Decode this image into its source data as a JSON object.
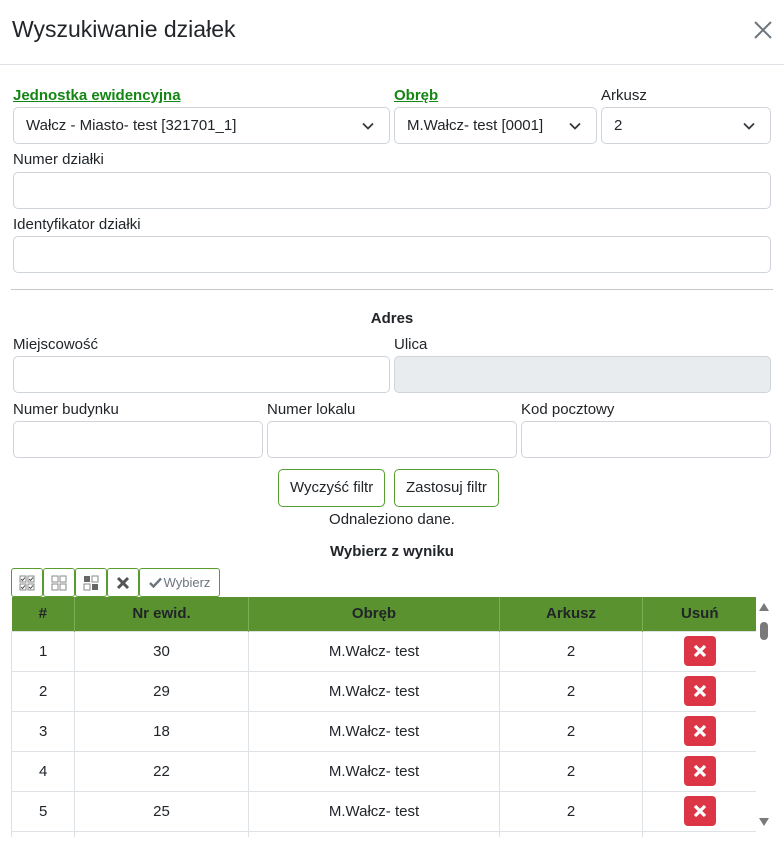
{
  "modal": {
    "title": "Wyszukiwanie działek"
  },
  "form": {
    "jednostka_label": "Jednostka ewidencyjna",
    "jednostka_value": "Wałcz - Miasto- test [321701_1]",
    "obreb_label": "Obręb",
    "obreb_value": "M.Wałcz- test [0001]",
    "arkusz_label": "Arkusz",
    "arkusz_value": "2",
    "numer_dzialki_label": "Numer działki",
    "identyfikator_label": "Identyfikator działki"
  },
  "address": {
    "heading": "Adres",
    "miejscowosc_label": "Miejscowość",
    "ulica_label": "Ulica",
    "numer_budynku_label": "Numer budynku",
    "numer_lokalu_label": "Numer lokalu",
    "kod_pocztowy_label": "Kod pocztowy"
  },
  "actions": {
    "clear_label": "Wyczyść filtr",
    "apply_label": "Zastosuj filtr",
    "status": "Odnaleziono dane."
  },
  "results": {
    "heading": "Wybierz z wyniku",
    "select_label": "Wybierz",
    "headers": [
      "#",
      "Nr ewid.",
      "Obręb",
      "Arkusz",
      "Usuń"
    ],
    "rows": [
      [
        "1",
        "30",
        "M.Wałcz- test",
        "2"
      ],
      [
        "2",
        "29",
        "M.Wałcz- test",
        "2"
      ],
      [
        "3",
        "18",
        "M.Wałcz- test",
        "2"
      ],
      [
        "4",
        "22",
        "M.Wałcz- test",
        "2"
      ],
      [
        "5",
        "25",
        "M.Wałcz- test",
        "2"
      ]
    ]
  },
  "colors": {
    "accent_green": "#5a9230",
    "label_green": "#138613",
    "delete_red": "#dc3545"
  }
}
